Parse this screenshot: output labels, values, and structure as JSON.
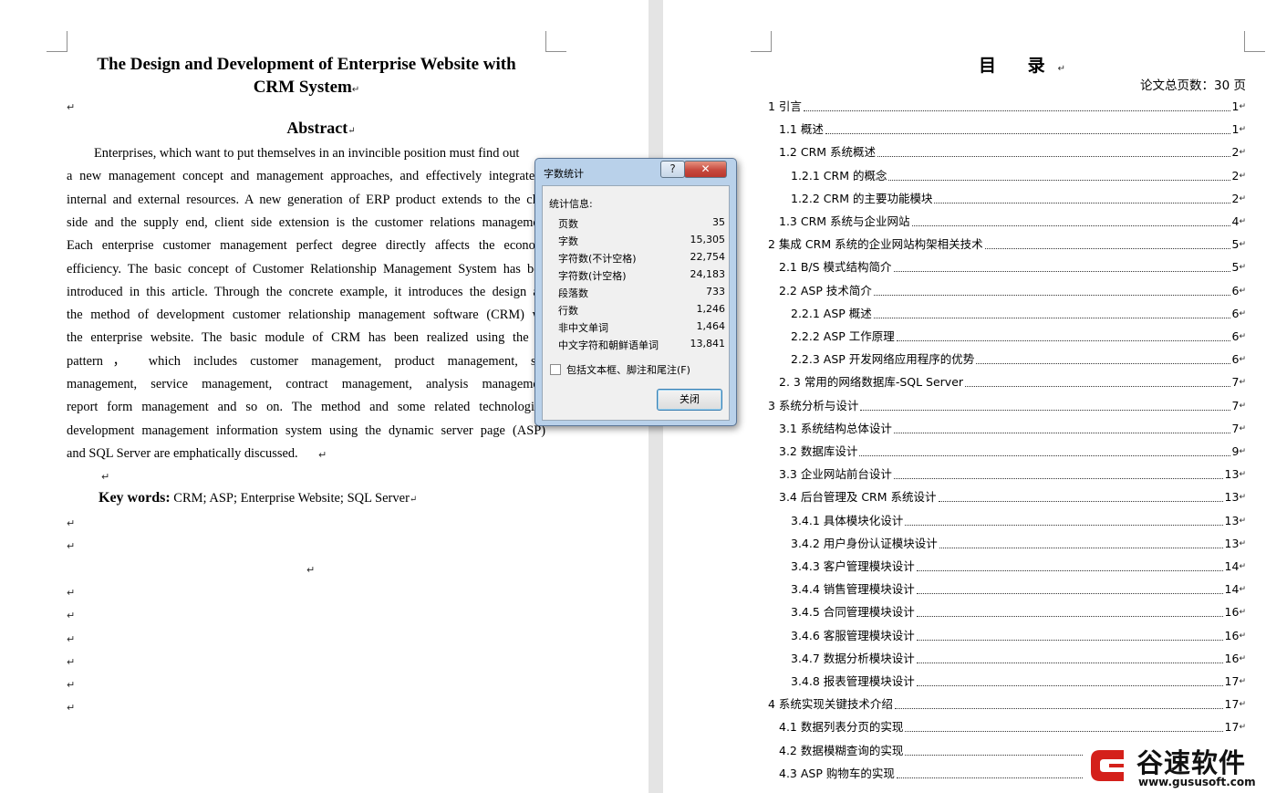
{
  "left_page": {
    "title_line1": "The Design and Development of Enterprise Website with",
    "title_line2": "CRM System",
    "abstract_heading": "Abstract",
    "abstract_lines": [
      "Enterprises, which want to put themselves in an invincible position must find out",
      "a new management concept and management approaches, and effectively integrate i",
      "internal and external resources. A new generation of ERP product extends to the clie",
      "side and the supply end, client side extension is the customer relations managemen",
      "Each enterprise customer management perfect degree directly affects the econom",
      "efficiency. The basic concept of Customer Relationship Management System has bee",
      "introduced in this article. Through the concrete example, it introduces the design an",
      "the method of development customer relationship management software (CRM) wi",
      "the enterprise website. The basic module of CRM has been realized using the B",
      "pattern， which includes customer management, product management, sal",
      "management, service management, contract management, analysis managemen",
      "report form management and so on. The method and some related technologies",
      "development management information system using the dynamic server page (ASP)",
      "and SQL Server are emphatically discussed."
    ],
    "keywords_label": "Key words:",
    "keywords_value": "CRM; ASP; Enterprise Website; SQL Server",
    "para_mark": "↵"
  },
  "right_page": {
    "toc_title": "目 录",
    "total_pages": "论文总页数：30 页",
    "toc": [
      {
        "label": "1 引言",
        "page": "1",
        "level": 0
      },
      {
        "label": "1.1 概述",
        "page": "1",
        "level": 1
      },
      {
        "label": "1.2 CRM 系统概述",
        "page": "2",
        "level": 1
      },
      {
        "label": "1.2.1 CRM 的概念",
        "page": "2",
        "level": 2
      },
      {
        "label": "1.2.2 CRM 的主要功能模块",
        "page": "2",
        "level": 2
      },
      {
        "label": "1.3 CRM 系统与企业网站",
        "page": "4",
        "level": 1
      },
      {
        "label": "2  集成 CRM 系统的企业网站构架相关技术",
        "page": "5",
        "level": 0
      },
      {
        "label": "2.1 B/S 模式结构简介",
        "page": "5",
        "level": 1
      },
      {
        "label": "2.2 ASP 技术简介",
        "page": "6",
        "level": 1
      },
      {
        "label": "2.2.1 ASP 概述",
        "page": "6",
        "level": 2
      },
      {
        "label": "2.2.2 ASP 工作原理",
        "page": "6",
        "level": 2
      },
      {
        "label": "2.2.3 ASP 开发网络应用程序的优势",
        "page": "6",
        "level": 2
      },
      {
        "label": "2. 3  常用的网络数据库-SQL Server",
        "page": "7",
        "level": 1
      },
      {
        "label": "3  系统分析与设计",
        "page": "7",
        "level": 0
      },
      {
        "label": "3.1  系统结构总体设计",
        "page": "7",
        "level": 1
      },
      {
        "label": "3.2  数据库设计",
        "page": "9",
        "level": 1
      },
      {
        "label": "3.3  企业网站前台设计",
        "page": "13",
        "level": 1
      },
      {
        "label": "3.4  后台管理及 CRM 系统设计",
        "page": "13",
        "level": 1
      },
      {
        "label": "3.4.1  具体模块化设计",
        "page": "13",
        "level": 2
      },
      {
        "label": "3.4.2  用户身份认证模块设计",
        "page": "13",
        "level": 2
      },
      {
        "label": "3.4.3  客户管理模块设计",
        "page": "14",
        "level": 2
      },
      {
        "label": "3.4.4  销售管理模块设计",
        "page": "14",
        "level": 2
      },
      {
        "label": "3.4.5  合同管理模块设计",
        "page": "16",
        "level": 2
      },
      {
        "label": "3.4.6  客服管理模块设计",
        "page": "16",
        "level": 2
      },
      {
        "label": "3.4.7  数据分析模块设计",
        "page": "16",
        "level": 2
      },
      {
        "label": "3.4.8  报表管理模块设计",
        "page": "17",
        "level": 2
      },
      {
        "label": "4  系统实现关键技术介绍",
        "page": "17",
        "level": 0
      },
      {
        "label": "4.1  数据列表分页的实现",
        "page": "17",
        "level": 1
      },
      {
        "label": "4.2  数据模糊查询的实现",
        "page": "2",
        "level": 1
      },
      {
        "label": "4.3 ASP 购物车的实现",
        "page": "21",
        "level": 1
      }
    ]
  },
  "dialog": {
    "title": "字数统计",
    "help": "?",
    "close_x": "✕",
    "group_label": "统计信息:",
    "stats": [
      {
        "label": "页数",
        "value": "35"
      },
      {
        "label": "字数",
        "value": "15,305"
      },
      {
        "label": "字符数(不计空格)",
        "value": "22,754"
      },
      {
        "label": "字符数(计空格)",
        "value": "24,183"
      },
      {
        "label": "段落数",
        "value": "733"
      },
      {
        "label": "行数",
        "value": "1,246"
      },
      {
        "label": "非中文单词",
        "value": "1,464"
      },
      {
        "label": "中文字符和朝鲜语单词",
        "value": "13,841"
      }
    ],
    "checkbox_label": "包括文本框、脚注和尾注(F)",
    "close_button": "关闭"
  },
  "watermark": {
    "name": "谷速软件",
    "url": "www.gususoft.com"
  },
  "colors": {
    "dialog_frame": "#b9d1ea",
    "close_x_button": "#c7493e",
    "logo_red": "#d4201a"
  }
}
